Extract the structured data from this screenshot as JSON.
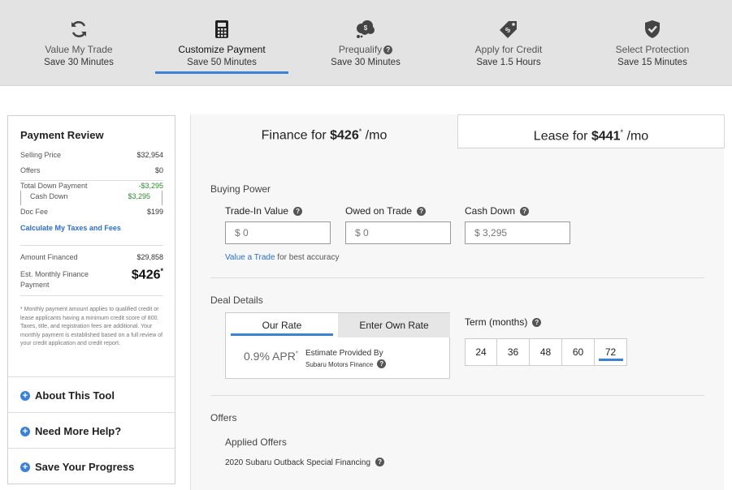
{
  "steps": [
    {
      "title": "Value My Trade",
      "sub": "Save 30 Minutes",
      "icon": "refresh-icon"
    },
    {
      "title": "Customize Payment",
      "sub": "Save 50 Minutes",
      "icon": "calculator-icon",
      "active": true
    },
    {
      "title": "Prequalify",
      "sub": "Save 30 Minutes",
      "icon": "money-cloud-icon"
    },
    {
      "title": "Apply for Credit",
      "sub": "Save 1.5 Hours",
      "icon": "price-tag-icon"
    },
    {
      "title": "Select Protection",
      "sub": "Save 15 Minutes",
      "icon": "shield-check-icon"
    }
  ],
  "review": {
    "title": "Payment Review",
    "selling_price_label": "Selling Price",
    "selling_price": "$32,954",
    "offers_label": "Offers",
    "offers": "$0",
    "total_down_label": "Total Down Payment",
    "total_down": "-$3,295",
    "cash_down_label": "Cash Down",
    "cash_down": "$3,295",
    "doc_fee_label": "Doc Fee",
    "doc_fee": "$199",
    "taxes_link": "Calculate My Taxes and Fees",
    "amount_financed_label": "Amount Financed",
    "amount_financed": "$29,858",
    "est_monthly_label": "Est. Monthly Finance Payment",
    "est_monthly": "$426",
    "asterisk": "*",
    "disclaimer": "* Monthly payment amount applies to qualified credit or lease applicants having a minimum credit score of 800.  Taxes, title, and registration fees are additional. Your monthly payment is established based on a full review of your credit application and credit report."
  },
  "accordion": [
    "About This Tool",
    "Need More Help?",
    "Save Your Progress"
  ],
  "tabs": {
    "finance_prefix": "Finance for ",
    "finance_amount": "$426",
    "finance_suffix": " /mo",
    "lease_prefix": "Lease for ",
    "lease_amount": "$441",
    "lease_suffix": " /mo",
    "asterisk": "*"
  },
  "buying_power": {
    "title": "Buying Power",
    "trade_in_label": "Trade-In Value",
    "trade_in_value": "$ 0",
    "owed_label": "Owed on Trade",
    "owed_value": "$ 0",
    "cash_down_label": "Cash Down",
    "cash_down_value": "$ 3,295",
    "value_trade_link": "Value a Trade",
    "value_trade_note": " for best accuracy"
  },
  "deal": {
    "title": "Deal Details",
    "our_rate_tab": "Our Rate",
    "own_rate_tab": "Enter Own Rate",
    "apr": "0.9% APR",
    "apr_asterisk": "*",
    "estimate_by": "Estimate Provided By",
    "estimate_source": "Subaru Motors Finance",
    "term_label": "Term (months)",
    "terms": [
      "24",
      "36",
      "48",
      "60",
      "72"
    ],
    "selected_term": "72"
  },
  "offers": {
    "title": "Offers",
    "applied_title": "Applied Offers",
    "offer": "2020 Subaru Outback Special Financing"
  },
  "colors": {
    "accent": "#3b82d6",
    "steps_bg": "#e3e3e3",
    "link": "#2a6fc9",
    "green": "#2e8b2e"
  }
}
